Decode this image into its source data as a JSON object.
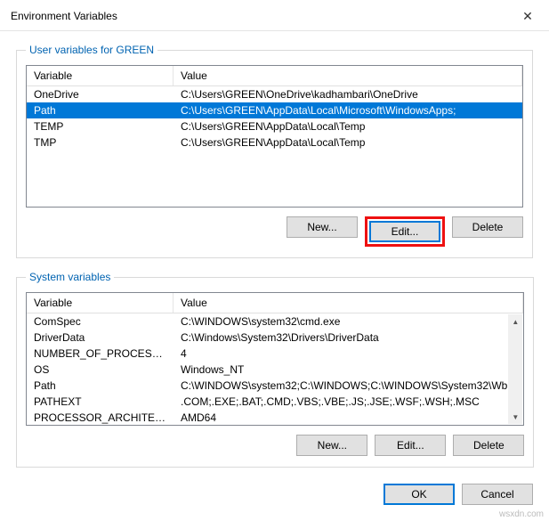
{
  "window": {
    "title": "Environment Variables",
    "close_icon": "✕"
  },
  "user_group": {
    "legend": "User variables for GREEN",
    "col_variable": "Variable",
    "col_value": "Value",
    "rows": [
      {
        "name": "OneDrive",
        "value": "C:\\Users\\GREEN\\OneDrive\\kadhambari\\OneDrive"
      },
      {
        "name": "Path",
        "value": "C:\\Users\\GREEN\\AppData\\Local\\Microsoft\\WindowsApps;"
      },
      {
        "name": "TEMP",
        "value": "C:\\Users\\GREEN\\AppData\\Local\\Temp"
      },
      {
        "name": "TMP",
        "value": "C:\\Users\\GREEN\\AppData\\Local\\Temp"
      }
    ],
    "selected_index": 1,
    "buttons": {
      "new": "New...",
      "edit": "Edit...",
      "delete": "Delete"
    }
  },
  "system_group": {
    "legend": "System variables",
    "col_variable": "Variable",
    "col_value": "Value",
    "rows": [
      {
        "name": "ComSpec",
        "value": "C:\\WINDOWS\\system32\\cmd.exe"
      },
      {
        "name": "DriverData",
        "value": "C:\\Windows\\System32\\Drivers\\DriverData"
      },
      {
        "name": "NUMBER_OF_PROCESSORS",
        "value": "4"
      },
      {
        "name": "OS",
        "value": "Windows_NT"
      },
      {
        "name": "Path",
        "value": "C:\\WINDOWS\\system32;C:\\WINDOWS;C:\\WINDOWS\\System32\\Wb..."
      },
      {
        "name": "PATHEXT",
        "value": ".COM;.EXE;.BAT;.CMD;.VBS;.VBE;.JS;.JSE;.WSF;.WSH;.MSC"
      },
      {
        "name": "PROCESSOR_ARCHITECTURE",
        "value": "AMD64"
      }
    ],
    "buttons": {
      "new": "New...",
      "edit": "Edit...",
      "delete": "Delete"
    }
  },
  "dialog": {
    "ok": "OK",
    "cancel": "Cancel"
  },
  "watermark": "wsxdn.com"
}
